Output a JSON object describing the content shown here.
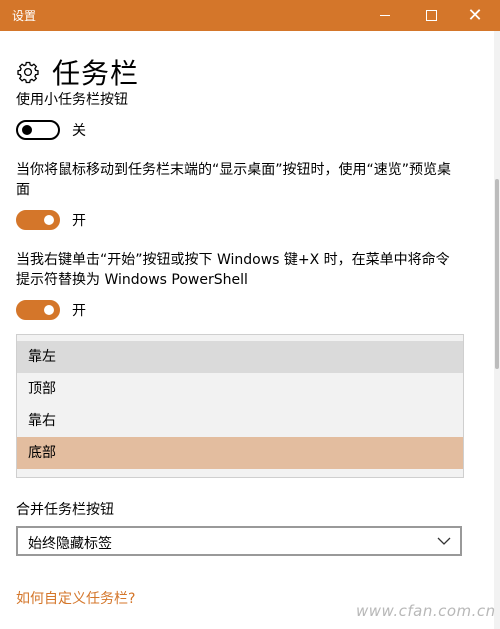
{
  "window": {
    "title": "设置",
    "minimize_icon": "minimize-icon",
    "maximize_icon": "maximize-icon",
    "close_icon": "close-icon",
    "accent_color": "#d4762a"
  },
  "header": {
    "icon": "gear-icon",
    "title": "任务栏"
  },
  "settings": [
    {
      "label": "使用小任务栏按钮",
      "state": "off",
      "state_text": "关"
    },
    {
      "label": "当你将鼠标移动到任务栏末端的“显示桌面”按钮时，使用“速览”预览桌面",
      "state": "on",
      "state_text": "开"
    },
    {
      "label": "当我右键单击“开始”按钮或按下 Windows 键+X 时，在菜单中将命令提示符替换为 Windows PowerShell",
      "state": "on",
      "state_text": "开"
    }
  ],
  "position_list": {
    "options": [
      "靠左",
      "顶部",
      "靠右",
      "底部"
    ],
    "highlighted": "靠左",
    "selected": "底部",
    "highlight_color": "#dadada",
    "selected_color": "#e3bd9f"
  },
  "combine_buttons": {
    "label": "合并任务栏按钮",
    "value": "始终隐藏标签",
    "icon": "chevron-down-icon"
  },
  "help_link": "如何自定义任务栏?",
  "watermark": "www.cfan.com.cn"
}
